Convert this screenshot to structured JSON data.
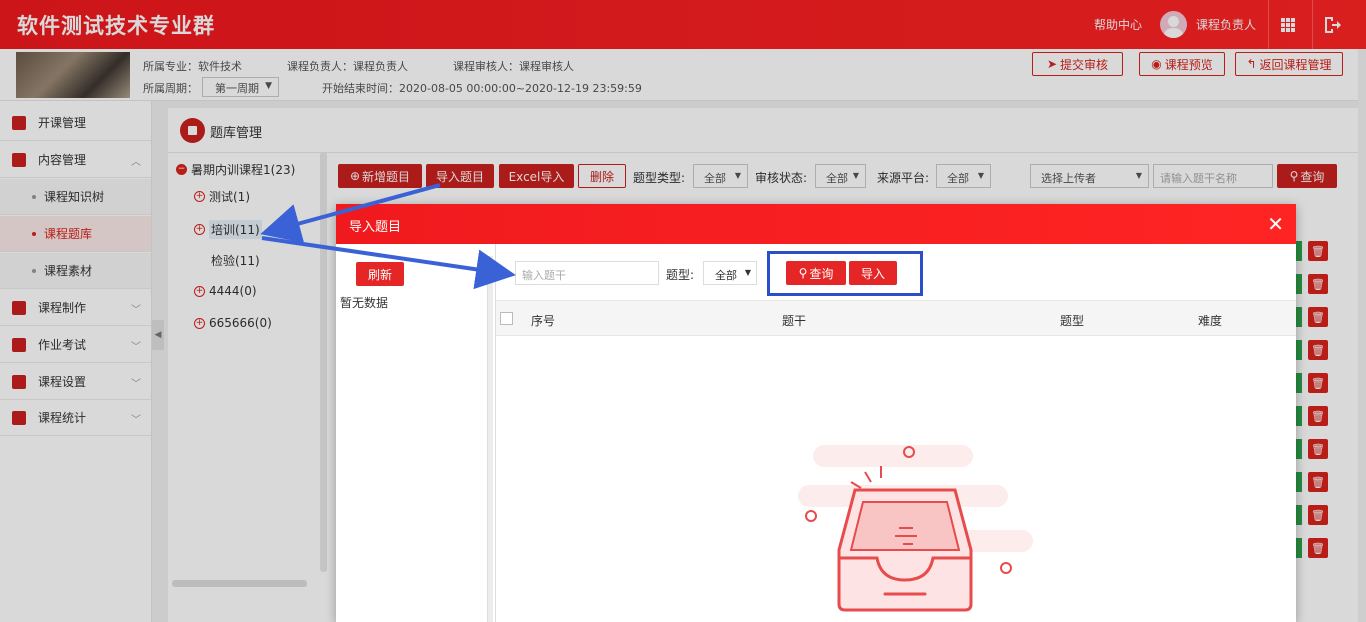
{
  "header": {
    "title": "软件测试技术专业群",
    "help": "帮助中心",
    "user": "课程负责人",
    "icons": [
      "grid-icon",
      "logout-icon"
    ]
  },
  "course_info": {
    "major": "所属专业：软件技术",
    "owner": "课程负责人：课程负责人",
    "reviewer": "课程审核人：课程审核人",
    "period_label": "所属周期：",
    "period_value": "第一周期",
    "time": "开始结束时间：2020-08-05 00:00:00~2020-12-19 23:59:59",
    "buttons": {
      "submit": "提交审核",
      "preview": "课程预览",
      "back": "返回课程管理"
    }
  },
  "sidebar": {
    "items": [
      {
        "label": "开课管理"
      },
      {
        "label": "内容管理"
      },
      {
        "label": "课程知识树"
      },
      {
        "label": "课程题库"
      },
      {
        "label": "课程素材"
      },
      {
        "label": "课程制作"
      },
      {
        "label": "作业考试"
      },
      {
        "label": "课程设置"
      },
      {
        "label": "课程统计"
      }
    ]
  },
  "main": {
    "title": "题库管理",
    "tree": {
      "root": "暑期内训课程1(23)",
      "nodes": [
        "测试(1)",
        "培训(11)",
        "检验(11)",
        "4444(0)",
        "665666(0)"
      ]
    },
    "toolbar": {
      "add": "新增题目",
      "import": "导入题目",
      "excel": "Excel导入",
      "delete": "删除",
      "type_label": "题型类型:",
      "type_value": "全部",
      "review_label": "审核状态:",
      "review_value": "全部",
      "source_label": "来源平台:",
      "source_value": "全部",
      "uploader_placeholder": "选择上传者",
      "search_placeholder": "请输入题干名称",
      "query": "查询"
    }
  },
  "modal": {
    "title": "导入题目",
    "refresh": "刷新",
    "no_data": "暂无数据",
    "search_placeholder": "输入题干",
    "type_label": "题型:",
    "type_value": "全部",
    "query": "查询",
    "import": "导入",
    "columns": [
      "序号",
      "题干",
      "题型",
      "难度"
    ]
  }
}
